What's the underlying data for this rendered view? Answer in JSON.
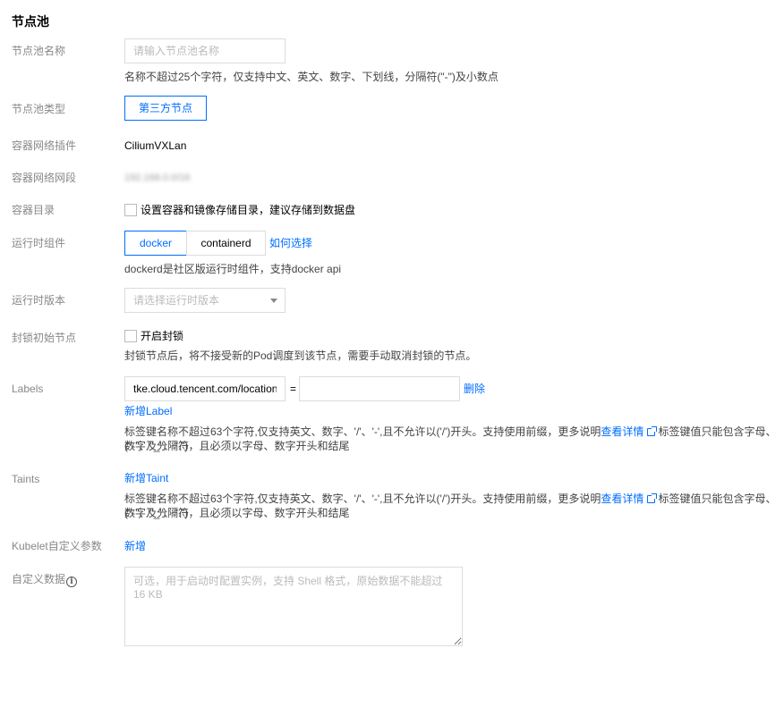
{
  "section_title": "节点池",
  "name": {
    "label": "节点池名称",
    "placeholder": "请输入节点池名称",
    "help": "名称不超过25个字符，仅支持中文、英文、数字、下划线，分隔符(\"-\")及小数点"
  },
  "type": {
    "label": "节点池类型",
    "option": "第三方节点"
  },
  "network_plugin": {
    "label": "容器网络插件",
    "value": "CiliumVXLan"
  },
  "network_cidr": {
    "label": "容器网络网段",
    "value": "192.168.0.0/16"
  },
  "container_dir": {
    "label": "容器目录",
    "checkbox_label": "设置容器和镜像存储目录，建议存储到数据盘"
  },
  "runtime": {
    "label": "运行时组件",
    "options": [
      "docker",
      "containerd"
    ],
    "selected": "docker",
    "how_link": "如何选择",
    "help": "dockerd是社区版运行时组件，支持docker api"
  },
  "runtime_version": {
    "label": "运行时版本",
    "placeholder": "请选择运行时版本"
  },
  "cordon": {
    "label": "封锁初始节点",
    "checkbox_label": "开启封锁",
    "help": "封锁节点后，将不接受新的Pod调度到该节点，需要手动取消封锁的节点。"
  },
  "labels": {
    "label": "Labels",
    "key_value": "tke.cloud.tencent.com/location",
    "equals": "=",
    "value_value": "",
    "delete_link": "删除",
    "add_link": "新增Label",
    "help_part1": "标签键名称不超过63个字符,仅支持英文、数字、'/'、'-',且不允许以('/')开头。支持使用前缀，更多说明",
    "detail_link": "查看详情",
    "help_part2": "标签键值只能包含字母、数字及分隔符",
    "help_line2": "(\"-\"、\"_\"、\".\")，且必须以字母、数字开头和结尾"
  },
  "taints": {
    "label": "Taints",
    "add_link": "新增Taint",
    "help_part1": "标签键名称不超过63个字符,仅支持英文、数字、'/'、'-',且不允许以('/')开头。支持使用前缀，更多说明",
    "detail_link": "查看详情",
    "help_part2": "标签键值只能包含字母、数字及分隔符",
    "help_line2": "(\"-\"、\"_\"、\".\")，且必须以字母、数字开头和结尾"
  },
  "kubelet": {
    "label": "Kubelet自定义参数",
    "add_link": "新增"
  },
  "custom_data": {
    "label": "自定义数据",
    "placeholder": "可选，用于启动时配置实例，支持 Shell 格式，原始数据不能超过 16 KB"
  },
  "colors": {
    "accent": "#006eff",
    "label": "#888888",
    "border": "#dcdcdc"
  },
  "icons": {
    "external_link": "external-link-icon",
    "info": "info-circle-icon",
    "dropdown": "chevron-down-icon"
  }
}
